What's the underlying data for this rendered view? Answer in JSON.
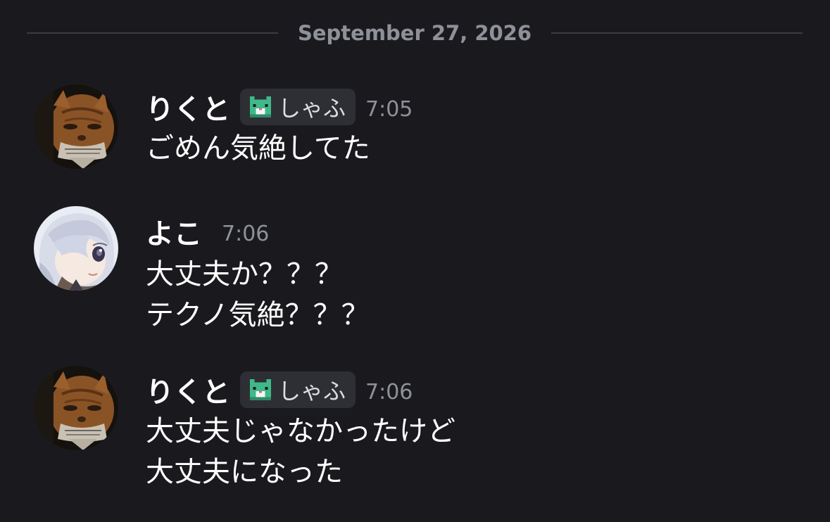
{
  "date_divider": {
    "text": "September 27, 2026"
  },
  "messages": [
    {
      "username": "りくと",
      "avatar": "cat-avatar",
      "tag": {
        "icon": "pixel-cat-icon",
        "label": "しゃふ"
      },
      "time": "7:05",
      "lines": [
        "ごめん気絶してた"
      ]
    },
    {
      "username": "よこ",
      "avatar": "anime-girl-avatar",
      "time": "7:06",
      "lines": [
        "大丈夫か？？？",
        "テクノ気絶？？？"
      ]
    },
    {
      "username": "りくと",
      "avatar": "cat-avatar",
      "tag": {
        "icon": "pixel-cat-icon",
        "label": "しゃふ"
      },
      "time": "7:06",
      "lines": [
        "大丈夫じゃなかったけど",
        "大丈夫になった"
      ]
    }
  ],
  "colors": {
    "background": "#1a1a1e",
    "text": "#ffffff",
    "muted": "#8f9199",
    "tag_bg": "#2e2f35",
    "tag_icon_green": "#3fb98a"
  }
}
